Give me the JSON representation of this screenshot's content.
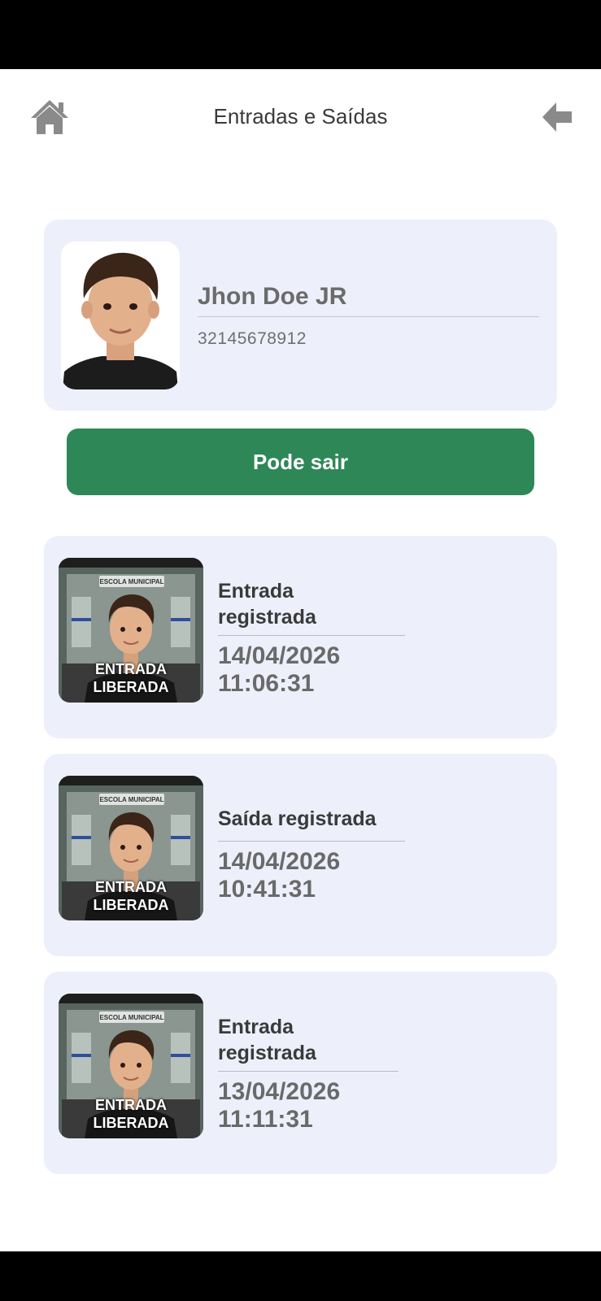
{
  "header": {
    "title": "Entradas e Saídas"
  },
  "student": {
    "name": "Jhon Doe JR",
    "id": "32145678912"
  },
  "action_button": {
    "label": "Pode sair",
    "color": "#2e8757"
  },
  "records": [
    {
      "title": "Entrada registrada",
      "date": "14/04/2026",
      "time": "11:06:31",
      "photo_sign": "ESCOLA MUNICIPAL",
      "overlay_line1": "ENTRADA",
      "overlay_line2": "LIBERADA"
    },
    {
      "title": "Saída registrada",
      "date": "14/04/2026",
      "time": "10:41:31",
      "photo_sign": "ESCOLA MUNICIPAL",
      "overlay_line1": "ENTRADA",
      "overlay_line2": "LIBERADA"
    },
    {
      "title": "Entrada registrada",
      "date": "13/04/2026",
      "time": "11:11:31",
      "photo_sign": "ESCOLA MUNICIPAL",
      "overlay_line1": "ENTRADA",
      "overlay_line2": "LIBERADA"
    }
  ],
  "colors": {
    "card_background": "#edf0fb",
    "icon_gray": "#8a8a8a"
  }
}
